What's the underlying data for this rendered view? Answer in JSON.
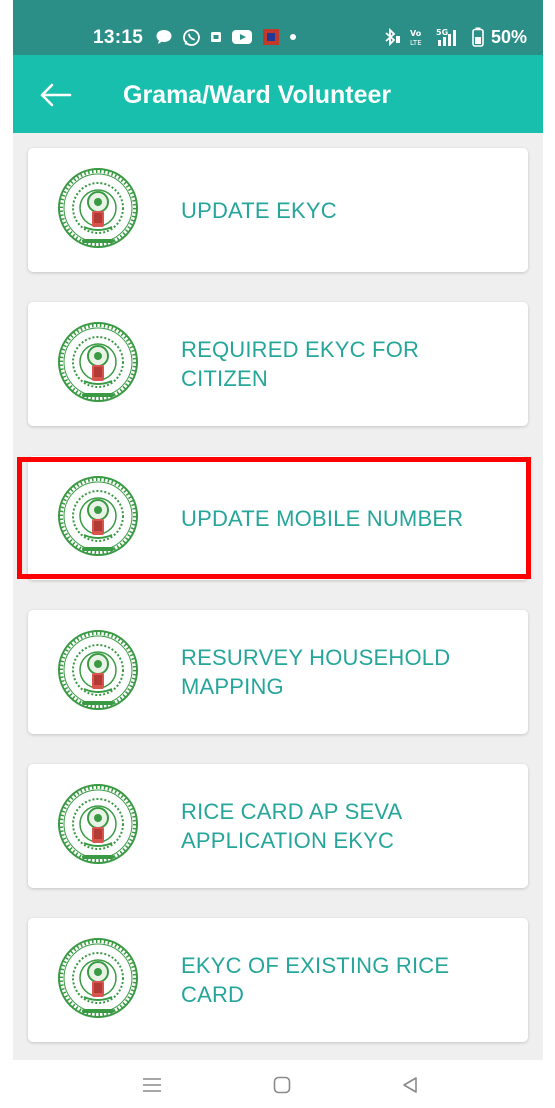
{
  "status_bar": {
    "time": "13:15",
    "battery": "50%",
    "left_icons": [
      "chat-bubble-icon",
      "whatsapp-icon",
      "sim-card-icon",
      "youtube-icon",
      "app-notification-icon",
      "more-dot-icon"
    ],
    "right_icons": [
      "bluetooth-icon",
      "volte-icon",
      "5g-signal-icon",
      "battery-icon"
    ]
  },
  "app_bar": {
    "back_icon": "back-arrow-icon",
    "title": "Grama/Ward Volunteer"
  },
  "menu": {
    "items": [
      {
        "label": "UPDATE EKYC",
        "icon": "ap-government-emblem-icon",
        "highlighted": false
      },
      {
        "label": "REQUIRED EKYC FOR CITIZEN",
        "icon": "ap-government-emblem-icon",
        "highlighted": false
      },
      {
        "label": "UPDATE MOBILE NUMBER",
        "icon": "ap-government-emblem-icon",
        "highlighted": true
      },
      {
        "label": "RESURVEY HOUSEHOLD MAPPING",
        "icon": "ap-government-emblem-icon",
        "highlighted": false
      },
      {
        "label": "RICE CARD AP SEVA APPLICATION EKYC",
        "icon": "ap-government-emblem-icon",
        "highlighted": false
      },
      {
        "label": "EKYC OF EXISTING RICE CARD",
        "icon": "ap-government-emblem-icon",
        "highlighted": false
      }
    ]
  },
  "nav_bar": {
    "icons": [
      "menu-icon",
      "home-icon",
      "back-icon"
    ]
  },
  "colors": {
    "status_bar": "#2b8f88",
    "app_bar": "#18bfac",
    "label_text": "#26a69a",
    "background": "#efefef",
    "highlight": "#ff0000",
    "emblem_green": "#3a9a44"
  }
}
